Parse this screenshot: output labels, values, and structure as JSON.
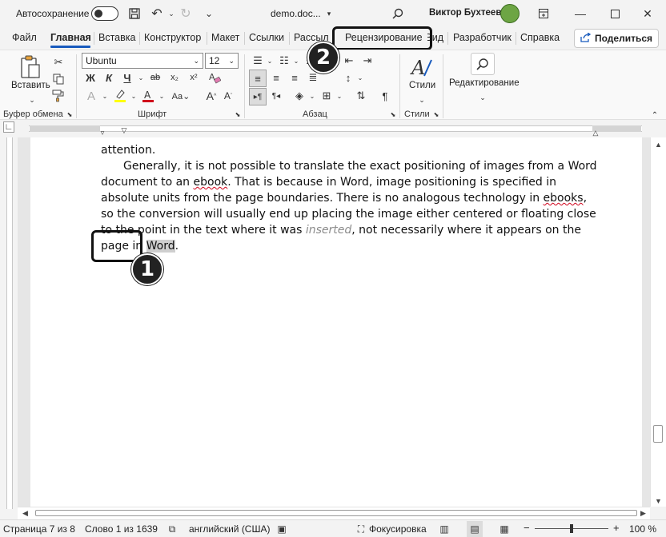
{
  "titlebar": {
    "autosave_label": "Автосохранение",
    "doc_name": "demo.doc...",
    "user_name": "Виктор Бухтеев"
  },
  "tabs": [
    "Файл",
    "Главная",
    "Вставка",
    "Конструктор",
    "Макет",
    "Ссылки",
    "Рассыл",
    "Рецензирование",
    "Вид",
    "Разработчик",
    "Справка"
  ],
  "share_label": "Поделиться",
  "ribbon": {
    "paste_label": "Вставить",
    "font_name": "Ubuntu",
    "font_size": "12",
    "bold": "Ж",
    "italic": "К",
    "underline": "Ч",
    "strike": "ab",
    "subscript": "x₂",
    "superscript": "x²",
    "styles_label": "Стили",
    "editing_label": "Редактирование",
    "groups": {
      "clipboard": "Буфер обмена",
      "font": "Шрифт",
      "paragraph": "Абзац",
      "styles": "Стили"
    }
  },
  "document": {
    "line0": "attention.",
    "p_a": "Generally, it is not possible to translate the exact positioning of images from a Word document to an ",
    "w_ebook": "ebook",
    "p_b": ". That is because in Word, image positioning is specified in absolute units from the page boundaries.  There is no analogous technology in ",
    "w_ebooks": "ebooks",
    "p_c": ", so the conversion will usually end up placing the image either centered or floating close to the point in the text where it was ",
    "w_inserted": "inserted",
    "p_d": ", not necessarily where it appears on the page in ",
    "w_word": "Word",
    "p_end": "."
  },
  "callouts": {
    "one": "1",
    "two": "2"
  },
  "statusbar": {
    "page": "Страница 7 из 8",
    "words": "Слово 1 из 1639",
    "language": "английский (США)",
    "focus": "Фокусировка",
    "zoom": "100 %"
  },
  "colors": {
    "accent": "#185abd",
    "highlight": "#ffff00",
    "font_color": "#d0021b"
  }
}
